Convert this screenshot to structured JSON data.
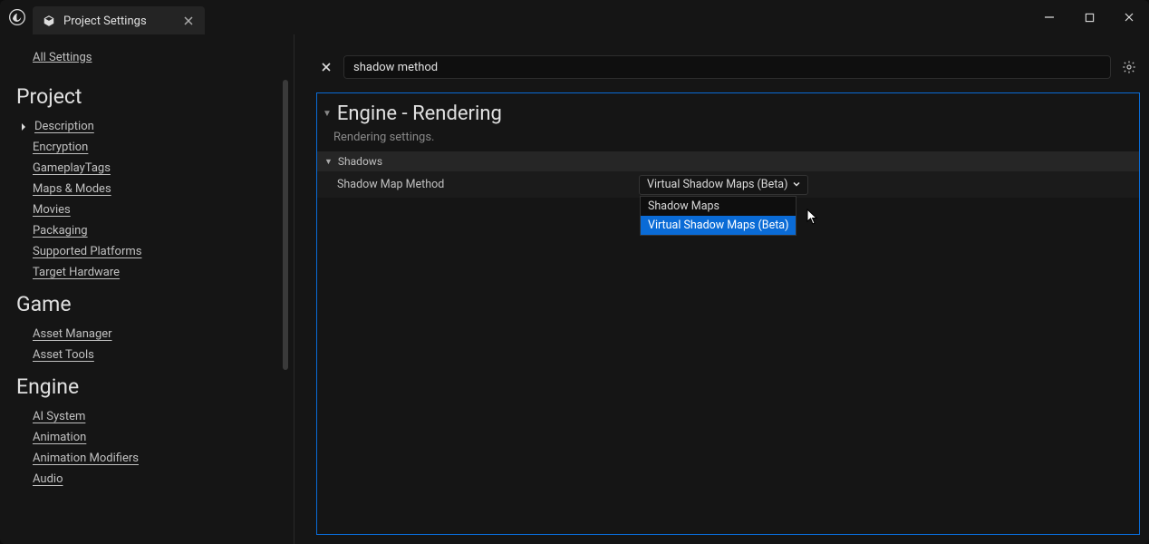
{
  "tab": {
    "title": "Project Settings"
  },
  "sidebar": {
    "all_settings": "All Settings",
    "sections": [
      {
        "title": "Project",
        "expanded_first": "Description",
        "items": [
          "Encryption",
          "GameplayTags",
          "Maps & Modes",
          "Movies",
          "Packaging",
          "Supported Platforms",
          "Target Hardware"
        ]
      },
      {
        "title": "Game",
        "items": [
          "Asset Manager",
          "Asset Tools"
        ]
      },
      {
        "title": "Engine",
        "items": [
          "AI System",
          "Animation",
          "Animation Modifiers",
          "Audio"
        ]
      }
    ]
  },
  "search": {
    "value": "shadow method"
  },
  "panel": {
    "title": "Engine - Rendering",
    "desc": "Rendering settings.",
    "group": "Shadows",
    "property": {
      "label": "Shadow Map Method",
      "selected": "Virtual Shadow Maps (Beta)",
      "options": [
        "Shadow Maps",
        "Virtual Shadow Maps (Beta)"
      ]
    }
  }
}
